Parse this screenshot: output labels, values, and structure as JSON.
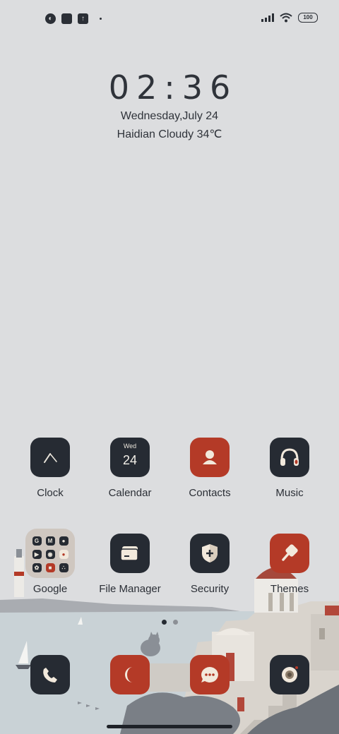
{
  "status_bar": {
    "left_icons": [
      "notification-app-icon",
      "notification-square-icon",
      "notification-upload-icon"
    ],
    "battery_level": "100"
  },
  "clock_widget": {
    "time": "02:36",
    "date": "Wednesday,July 24",
    "weather": "Haidian Cloudy 34℃"
  },
  "apps_row1": [
    {
      "label": "Clock",
      "icon": "clock-icon"
    },
    {
      "label": "Calendar",
      "icon": "calendar-icon",
      "day": "Wed",
      "date": "24"
    },
    {
      "label": "Contacts",
      "icon": "contacts-icon"
    },
    {
      "label": "Music",
      "icon": "music-icon"
    }
  ],
  "apps_row2": [
    {
      "label": "Google",
      "icon": "google-folder-icon"
    },
    {
      "label": "File Manager",
      "icon": "file-manager-icon"
    },
    {
      "label": "Security",
      "icon": "security-icon"
    },
    {
      "label": "Themes",
      "icon": "themes-icon"
    }
  ],
  "google_folder_apps": [
    "G",
    "M",
    "Maps",
    "YouTube",
    "Play",
    "Chrome",
    "Photos",
    "Meet",
    "Assistant"
  ],
  "page_indicator": {
    "count": 2,
    "active": 0
  },
  "dock": [
    {
      "name": "phone",
      "icon": "phone-icon"
    },
    {
      "name": "browser",
      "icon": "moon-browser-icon"
    },
    {
      "name": "messages",
      "icon": "messages-icon"
    },
    {
      "name": "camera",
      "icon": "camera-icon"
    }
  ],
  "colors": {
    "background": "#dcdddf",
    "icon_dark": "#262b33",
    "icon_red": "#b43a27",
    "icon_cream": "#f2e9dc"
  }
}
